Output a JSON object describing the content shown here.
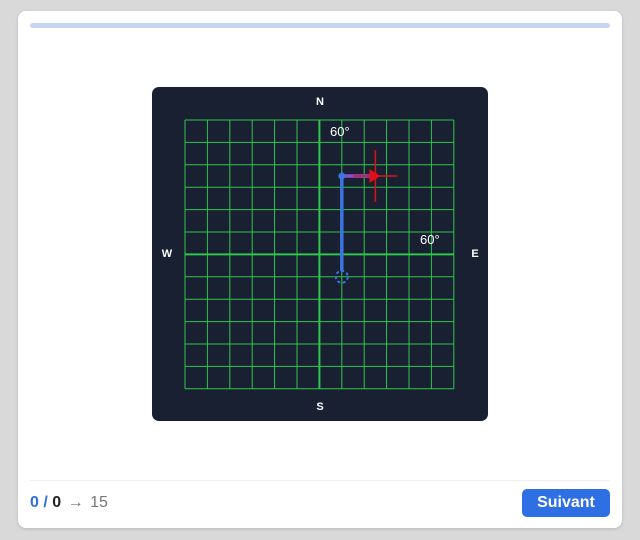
{
  "progress": {
    "fraction": 0
  },
  "compass": {
    "north": "N",
    "south": "S",
    "west": "W",
    "east": "E"
  },
  "angles": {
    "top": "60°",
    "right": "60°"
  },
  "score": {
    "done": "0",
    "separator": "/",
    "correct": "0",
    "arrow": "→",
    "total": "15"
  },
  "next_button": {
    "label": "Suivant"
  },
  "colors": {
    "accent": "#2f6fe4",
    "board": "#182032",
    "grid": "#2fc64a",
    "path": "#3b73e0",
    "target": "#e0101a",
    "segment": "#8a4fd8"
  }
}
